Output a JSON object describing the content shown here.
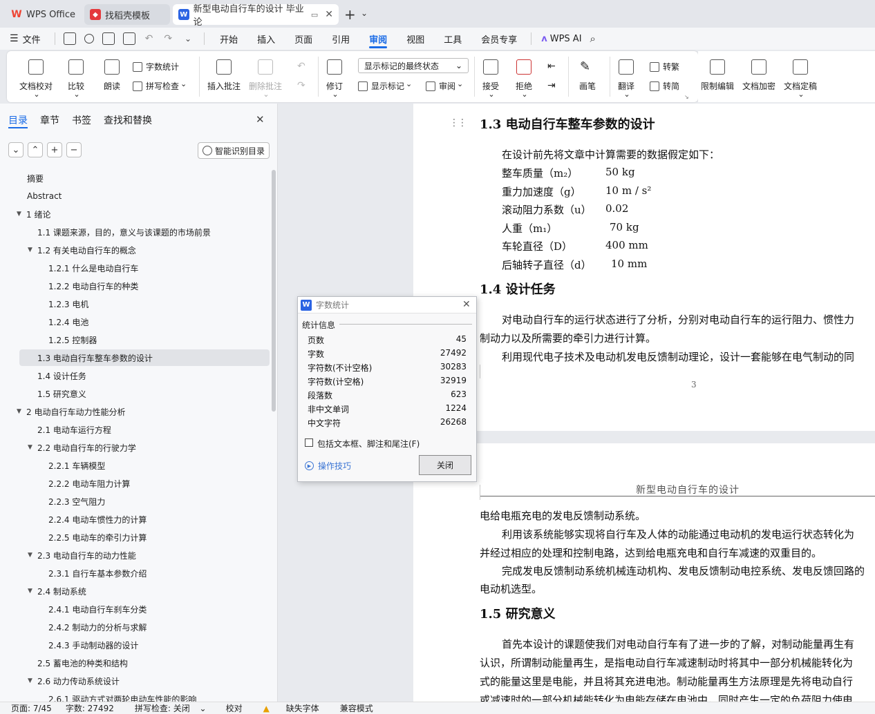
{
  "titlebar": {
    "tabs": [
      {
        "label": "WPS Office"
      },
      {
        "label": "找稻壳模板"
      },
      {
        "label": "新型电动自行车的设计 毕业论"
      }
    ]
  },
  "menubar": {
    "file": "文件",
    "items": [
      "开始",
      "插入",
      "页面",
      "引用",
      "审阅",
      "视图",
      "工具",
      "会员专享"
    ],
    "ai": "WPS AI"
  },
  "ribbon": {
    "doc_check": "文档校对",
    "compare": "比较",
    "read": "朗读",
    "word_count": "字数统计",
    "spell_check": "拼写检查",
    "insert_comment": "插入批注",
    "delete_comment": "删除批注",
    "revise": "修订",
    "markup_state": "显示标记的最终状态",
    "show_markup": "显示标记",
    "review": "审阅",
    "accept": "接受",
    "reject": "拒绝",
    "pen": "画笔",
    "translate": "翻译",
    "to_traditional": "转繁",
    "to_simplified": "转简",
    "restrict_edit": "限制编辑",
    "encrypt": "文档加密",
    "finalize": "文档定稿"
  },
  "nav": {
    "tabs": [
      "目录",
      "章节",
      "书签",
      "查找和替换"
    ],
    "smart_toc": "智能识别目录",
    "items": [
      {
        "text": "摘要",
        "level": 0,
        "exp": false
      },
      {
        "text": "Abstract",
        "level": 0,
        "exp": false
      },
      {
        "text": "1   绪论",
        "level": 0,
        "exp": true
      },
      {
        "text": "1.1  课题来源，目的，意义与该课题的市场前景",
        "level": 1,
        "exp": false
      },
      {
        "text": "1.2  有关电动自行车的概念",
        "level": 1,
        "exp": true
      },
      {
        "text": "1.2.1  什么是电动自行车",
        "level": 2,
        "exp": false
      },
      {
        "text": "1.2.2  电动自行车的种类",
        "level": 2,
        "exp": false
      },
      {
        "text": "1.2.3  电机",
        "level": 2,
        "exp": false
      },
      {
        "text": "1.2.4  电池",
        "level": 2,
        "exp": false
      },
      {
        "text": "1.2.5  控制器",
        "level": 2,
        "exp": false
      },
      {
        "text": "1.3  电动自行车整车参数的设计",
        "level": 1,
        "exp": false,
        "selected": true
      },
      {
        "text": "1.4  设计任务",
        "level": 1,
        "exp": false
      },
      {
        "text": "1.5  研究意义",
        "level": 1,
        "exp": false
      },
      {
        "text": "2  电动自行车动力性能分析",
        "level": 0,
        "exp": true
      },
      {
        "text": "2.1  电动车运行方程",
        "level": 1,
        "exp": false
      },
      {
        "text": "2.2  电动自行车的行驶力学",
        "level": 1,
        "exp": true
      },
      {
        "text": "2.2.1  车辆模型",
        "level": 2,
        "exp": false
      },
      {
        "text": "2.2.2  电动车阻力计算",
        "level": 2,
        "exp": false
      },
      {
        "text": "2.2.3  空气阻力",
        "level": 2,
        "exp": false
      },
      {
        "text": "2.2.4  电动车惯性力的计算",
        "level": 2,
        "exp": false
      },
      {
        "text": "2.2.5  电动车的牵引力计算",
        "level": 2,
        "exp": false
      },
      {
        "text": "2.3  电动自行车的动力性能",
        "level": 1,
        "exp": true
      },
      {
        "text": "2.3.1  自行车基本参数介绍",
        "level": 2,
        "exp": false
      },
      {
        "text": "2.4  制动系统",
        "level": 1,
        "exp": true
      },
      {
        "text": "2.4.1  电动自行车刹车分类",
        "level": 2,
        "exp": false
      },
      {
        "text": "2.4.2  制动力的分析与求解",
        "level": 2,
        "exp": false
      },
      {
        "text": "2.4.3  手动制动器的设计",
        "level": 2,
        "exp": false
      },
      {
        "text": "2.5  蓄电池的种类和结构",
        "level": 1,
        "exp": false
      },
      {
        "text": "2.6  动力传动系统设计",
        "level": 1,
        "exp": true
      },
      {
        "text": "2.6.1  驱动方式对两轮电动车性能的影响",
        "level": 2,
        "exp": false
      }
    ]
  },
  "doc": {
    "h13": "1.3  电动自行车整车参数的设计",
    "intro": "在设计前先将文章中计算需要的数据假定如下：",
    "params": [
      {
        "label": "整车质量（m₂）",
        "value": "50 kg"
      },
      {
        "label": "重力加速度（g）",
        "value": "10 m / s²"
      },
      {
        "label": "滚动阻力系数（u）",
        "value": "0.02"
      },
      {
        "label": "人重（m₁）",
        "value": "70 kg"
      },
      {
        "label": "车轮直径（D）",
        "value": "400 mm"
      },
      {
        "label": "后轴转子直径（d）",
        "value": "10 mm"
      }
    ],
    "h14": "1.4  设计任务",
    "p14a": "对电动自行车的运行状态进行了分析，分别对电动自行车的运行阻力、惯性力",
    "p14b": "制动力以及所需要的牵引力进行计算。",
    "p14c": "利用现代电子技术及电动机发电反馈制动理论，设计一套能够在电气制动的同",
    "page_no": "3",
    "header": "新型电动自行车的设计",
    "p2a": "电给电瓶充电的发电反馈制动系统。",
    "p2b": "利用该系统能够实现将自行车及人体的动能通过电动机的发电运行状态转化为",
    "p2c": "并经过相应的处理和控制电路，达到给电瓶充电和自行车减速的双重目的。",
    "p2d": "完成发电反馈制动系统机械连动机构、发电反馈制动电控系统、发电反馈回路的",
    "p2e": "电动机选型。",
    "h15": "1.5  研究意义",
    "p15a": "首先本设计的课题使我们对电动自行车有了进一步的了解，对制动能量再生有",
    "p15b": "认识，所谓制动能量再生，是指电动自行车减速制动时将其中一部分机械能转化为",
    "p15c": "式的能量这里是电能，并且将其充进电池。制动能量再生方法原理是先将电动自行",
    "p15d": "或减速时的一部分机械能转化为电能存储在电池中，同时产生一定的负荷阻力使电"
  },
  "dialog": {
    "title": "字数统计",
    "section": "统计信息",
    "rows": [
      {
        "k": "页数",
        "v": "45"
      },
      {
        "k": "字数",
        "v": "27492"
      },
      {
        "k": "字符数(不计空格)",
        "v": "30283"
      },
      {
        "k": "字符数(计空格)",
        "v": "32919"
      },
      {
        "k": "段落数",
        "v": "623"
      },
      {
        "k": "非中文单词",
        "v": "1224"
      },
      {
        "k": "中文字符",
        "v": "26268"
      }
    ],
    "checkbox": "包括文本框、脚注和尾注(F)",
    "tips": "操作技巧",
    "close": "关闭"
  },
  "status": {
    "page": "页面: 7/45",
    "words": "字数: 27492",
    "spell": "拼写检查: 关闭",
    "proof": "校对",
    "missing_font": "缺失字体",
    "compat": "兼容模式"
  }
}
